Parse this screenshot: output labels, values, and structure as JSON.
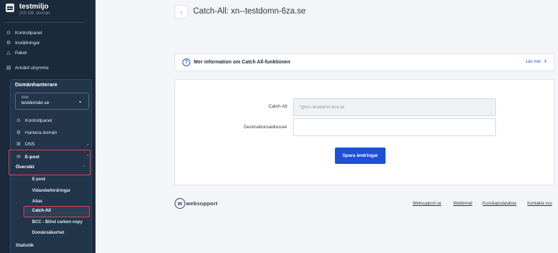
{
  "account": {
    "name": "testmiljo",
    "subtitle": "200 GB, domain"
  },
  "sidebar": {
    "items": [
      {
        "label": "Kontrollpanel",
        "icon": "dashboard-icon"
      },
      {
        "label": "Inställningar",
        "icon": "gear-icon"
      },
      {
        "label": "Paket",
        "icon": "package-icon"
      },
      {
        "label": "Använt utrymme",
        "icon": "storage-icon"
      }
    ],
    "domain_section": {
      "title": "Domänhanterare",
      "select_label": "Web",
      "select_value": "testdomän.se",
      "items": [
        {
          "label": "Kontrollpanel",
          "icon": "dashboard-icon"
        },
        {
          "label": "Hantera domän",
          "icon": "gear-icon"
        },
        {
          "label": "DNS",
          "icon": "dns-icon"
        },
        {
          "label": "E-post",
          "icon": "mail-icon"
        }
      ],
      "email_submenu": {
        "title": "Översikt",
        "items": [
          "E-post",
          "Vidarebefordringar",
          "Alias",
          "Catch-All",
          "BCC - Blind carbon copy",
          "Domänsäkerhet"
        ]
      },
      "stats_label": "Statistik"
    }
  },
  "page": {
    "title": "Catch-All: xn--testdomn-6za.se"
  },
  "info": {
    "text": "Mer information om Catch All-funktionen",
    "link": "Läs mer"
  },
  "form": {
    "catchall_label": "Catch-All",
    "catchall_value": "*@xn--testdomn-6za.se",
    "destinations_label": "Destinationsadresser",
    "destinations_value": "",
    "save_label": "Spara ändringar"
  },
  "footer": {
    "logo_text": "websupport",
    "links": [
      "Websupport.se",
      "Webbmail",
      "Kunskapsdatabas",
      "Kontakta oss"
    ]
  },
  "colors": {
    "sidebar": "#1b2a3b",
    "accent": "#1f4fd6",
    "highlight": "#e0424b"
  }
}
